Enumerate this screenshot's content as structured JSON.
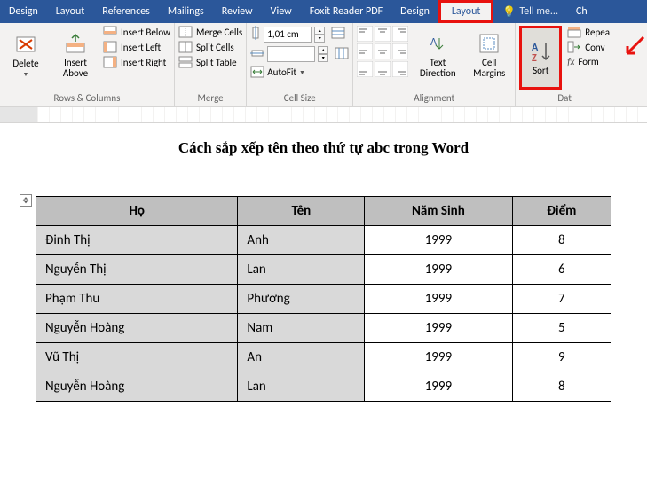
{
  "tabs": {
    "design": "Design",
    "layout": "Layout",
    "references": "References",
    "mailings": "Mailings",
    "review": "Review",
    "view": "View",
    "foxit": "Foxit Reader PDF",
    "design2": "Design",
    "layout2": "Layout",
    "tellme": "Tell me...",
    "last": "Ch"
  },
  "ribbon": {
    "delete": "Delete",
    "insert_above": "Insert Above",
    "insert_below": "Insert Below",
    "insert_left": "Insert Left",
    "insert_right": "Insert Right",
    "rows_cols": "Rows & Columns",
    "merge_cells": "Merge Cells",
    "split_cells": "Split Cells",
    "split_table": "Split Table",
    "merge": "Merge",
    "height_val": "1,01 cm",
    "autofit": "AutoFit",
    "cell_size": "Cell Size",
    "text_direction": "Text Direction",
    "cell_margins": "Cell Margins",
    "alignment": "Alignment",
    "sort": "Sort",
    "repeat": "Repea",
    "convert": "Conv",
    "formula": "Form",
    "data": "Dat"
  },
  "doc": {
    "title": "Cách sắp xếp tên theo thứ tự abc trong Word",
    "headers": [
      "Họ",
      "Tên",
      "Năm Sinh",
      "Điểm"
    ],
    "rows": [
      [
        "Đinh Thị",
        "Anh",
        "1999",
        "8"
      ],
      [
        "Nguyễn Thị",
        "Lan",
        "1999",
        "6"
      ],
      [
        "Phạm Thu",
        "Phương",
        "1999",
        "7"
      ],
      [
        "Nguyễn Hoàng",
        "Nam",
        "1999",
        "5"
      ],
      [
        "Vũ Thị",
        "An",
        "1999",
        "9"
      ],
      [
        "Nguyễn Hoàng",
        "Lan",
        "1999",
        "8"
      ]
    ]
  }
}
